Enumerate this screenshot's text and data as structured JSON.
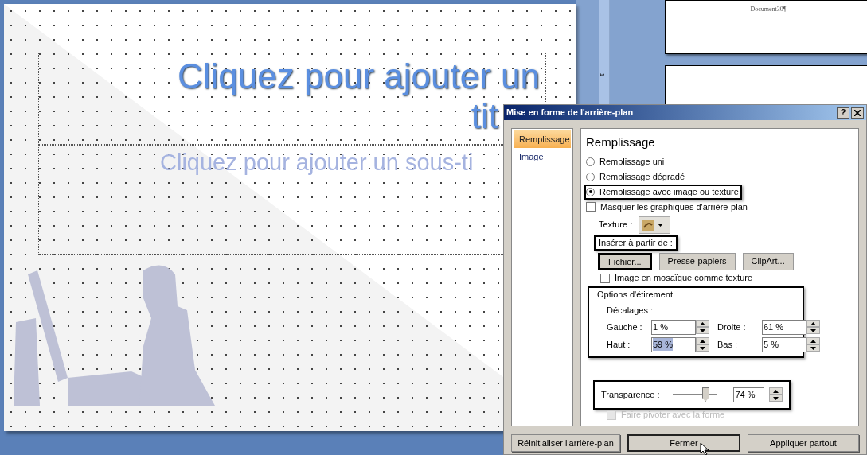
{
  "slide": {
    "title_lines": [
      "Cliquez pour ajouter un",
      "tit"
    ],
    "subtitle": "Cliquez pour ajouter un sous-ti"
  },
  "side_page": {
    "text": "Document30¶"
  },
  "ruler": {
    "label": "1"
  },
  "dialog": {
    "title": "Mise en forme de l'arrière-plan",
    "help": "?",
    "nav": [
      {
        "label": "Remplissage",
        "selected": true
      },
      {
        "label": "Image",
        "selected": false
      }
    ],
    "section_title": "Remplissage",
    "fill_options": [
      {
        "label": "Remplissage uni",
        "selected": false,
        "highlighted": false
      },
      {
        "label": "Remplissage dégradé",
        "selected": false,
        "highlighted": false
      },
      {
        "label": "Remplissage avec image ou texture",
        "selected": true,
        "highlighted": true
      }
    ],
    "hide_graphics": {
      "label": "Masquer les graphiques d'arrière-plan",
      "checked": false
    },
    "texture_label": "Texture :",
    "insert": {
      "label": "Insérer à partir de :",
      "highlighted": true
    },
    "insert_buttons": [
      {
        "label": "Fichier...",
        "highlighted": true
      },
      {
        "label": "Presse-papiers",
        "highlighted": false
      },
      {
        "label": "ClipArt...",
        "highlighted": false
      }
    ],
    "tile": {
      "label": "Image en mosaïque comme texture",
      "checked": false
    },
    "stretch": {
      "legend": "Options d'étirement",
      "offsets_label": "Décalages :",
      "highlighted": true,
      "fields": [
        {
          "label": "Gauche :",
          "value": "1 %",
          "selected": false
        },
        {
          "label": "Droite :",
          "value": "61 %",
          "selected": false
        },
        {
          "label": "Haut :",
          "value": "59 %",
          "selected": true
        },
        {
          "label": "Bas :",
          "value": "5 %",
          "selected": false
        }
      ]
    },
    "transparency": {
      "label": "Transparence :",
      "level": 0.74,
      "value": "74 %",
      "highlighted": true
    },
    "rotate": {
      "label": "Faire pivoter avec la forme",
      "checked": false,
      "disabled": true
    },
    "footer_buttons": [
      {
        "label": "Réinitialiser l'arrière-plan",
        "default": false
      },
      {
        "label": "Fermer",
        "default": true
      },
      {
        "label": "Appliquer partout",
        "default": false
      }
    ]
  }
}
